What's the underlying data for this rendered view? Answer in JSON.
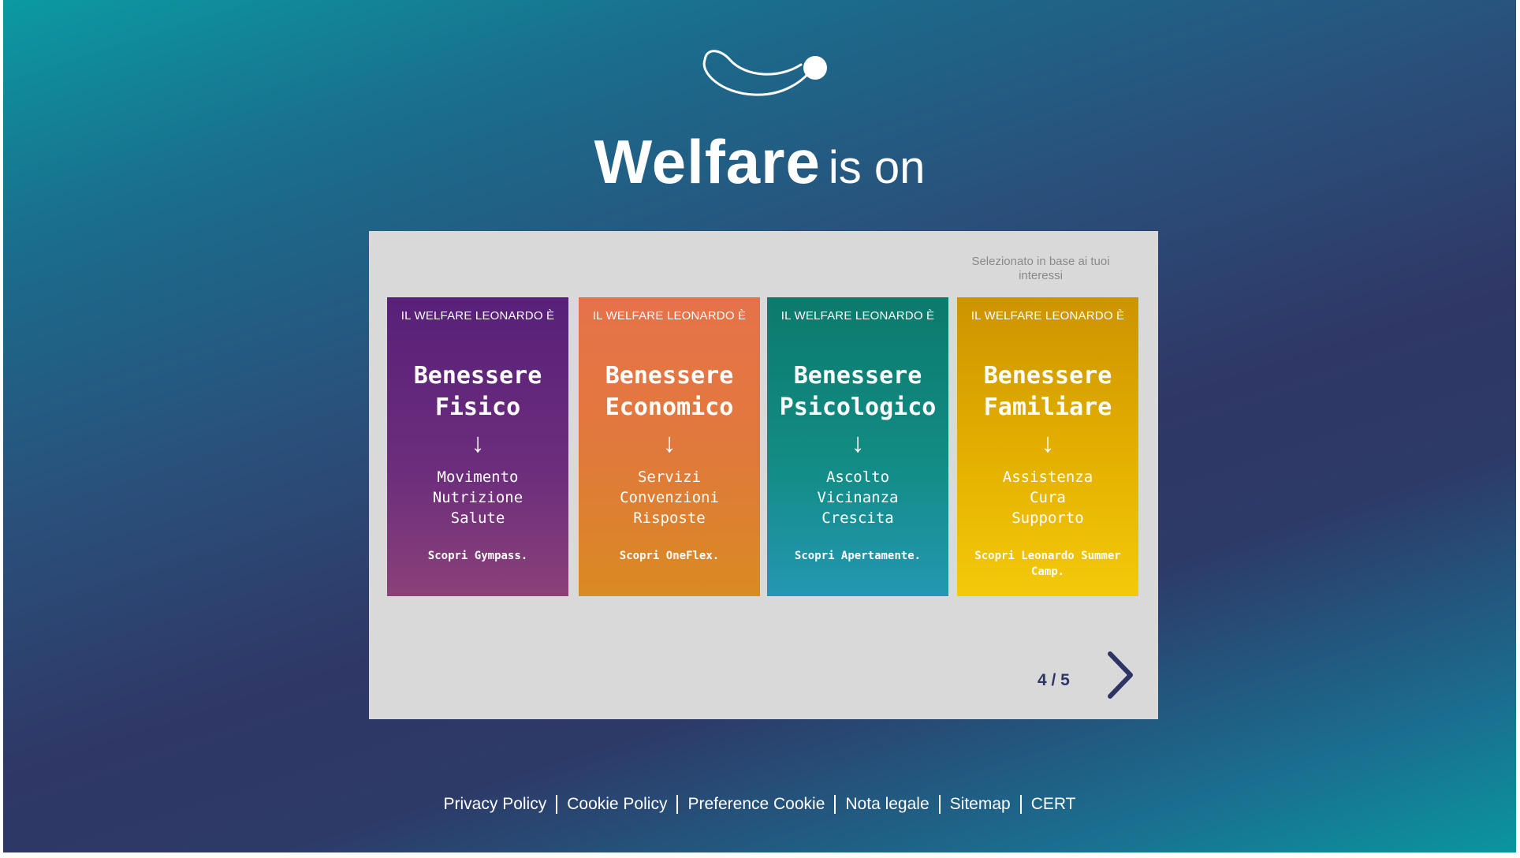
{
  "hero": {
    "title_bold": "Welfare",
    "title_light": "is on"
  },
  "carousel": {
    "note": "Selezionato in base ai tuoi interessi",
    "pager": "4 / 5",
    "next_icon": "chevron-right-icon",
    "cards": [
      {
        "kicker": "IL WELFARE LEONARDO È",
        "title_line1": "Benessere",
        "title_line2": "Fisico",
        "arrow": "↓",
        "items": [
          "Movimento",
          "Nutrizione",
          "Salute"
        ],
        "cta": "Scopri Gympass.",
        "color": "#6d2e7c"
      },
      {
        "kicker": "IL WELFARE LEONARDO È",
        "title_line1": "Benessere",
        "title_line2": "Economico",
        "arrow": "↓",
        "items": [
          "Servizi",
          "Convenzioni",
          "Risposte"
        ],
        "cta": "Scopri OneFlex.",
        "color": "#e07a3a"
      },
      {
        "kicker": "IL WELFARE LEONARDO È",
        "title_line1": "Benessere",
        "title_line2": "Psicologico",
        "arrow": "↓",
        "items": [
          "Ascolto",
          "Vicinanza",
          "Crescita"
        ],
        "cta": "Scopri Apertamente.",
        "color": "#128c84"
      },
      {
        "kicker": "IL WELFARE LEONARDO È",
        "title_line1": "Benessere",
        "title_line2": "Familiare",
        "arrow": "↓",
        "items": [
          "Assistenza",
          "Cura",
          "Supporto"
        ],
        "cta": "Scopri Leonardo Summer Camp.",
        "color": "#e4b100"
      }
    ]
  },
  "footer": {
    "links": [
      "Privacy Policy",
      "Cookie Policy",
      "Preference Cookie",
      "Nota legale",
      "Sitemap",
      "CERT"
    ]
  },
  "colors": {
    "background_start": "#0b9aa2",
    "background_mid": "#2f3766",
    "panel": "#d9d9d9",
    "pager": "#2d3566"
  }
}
